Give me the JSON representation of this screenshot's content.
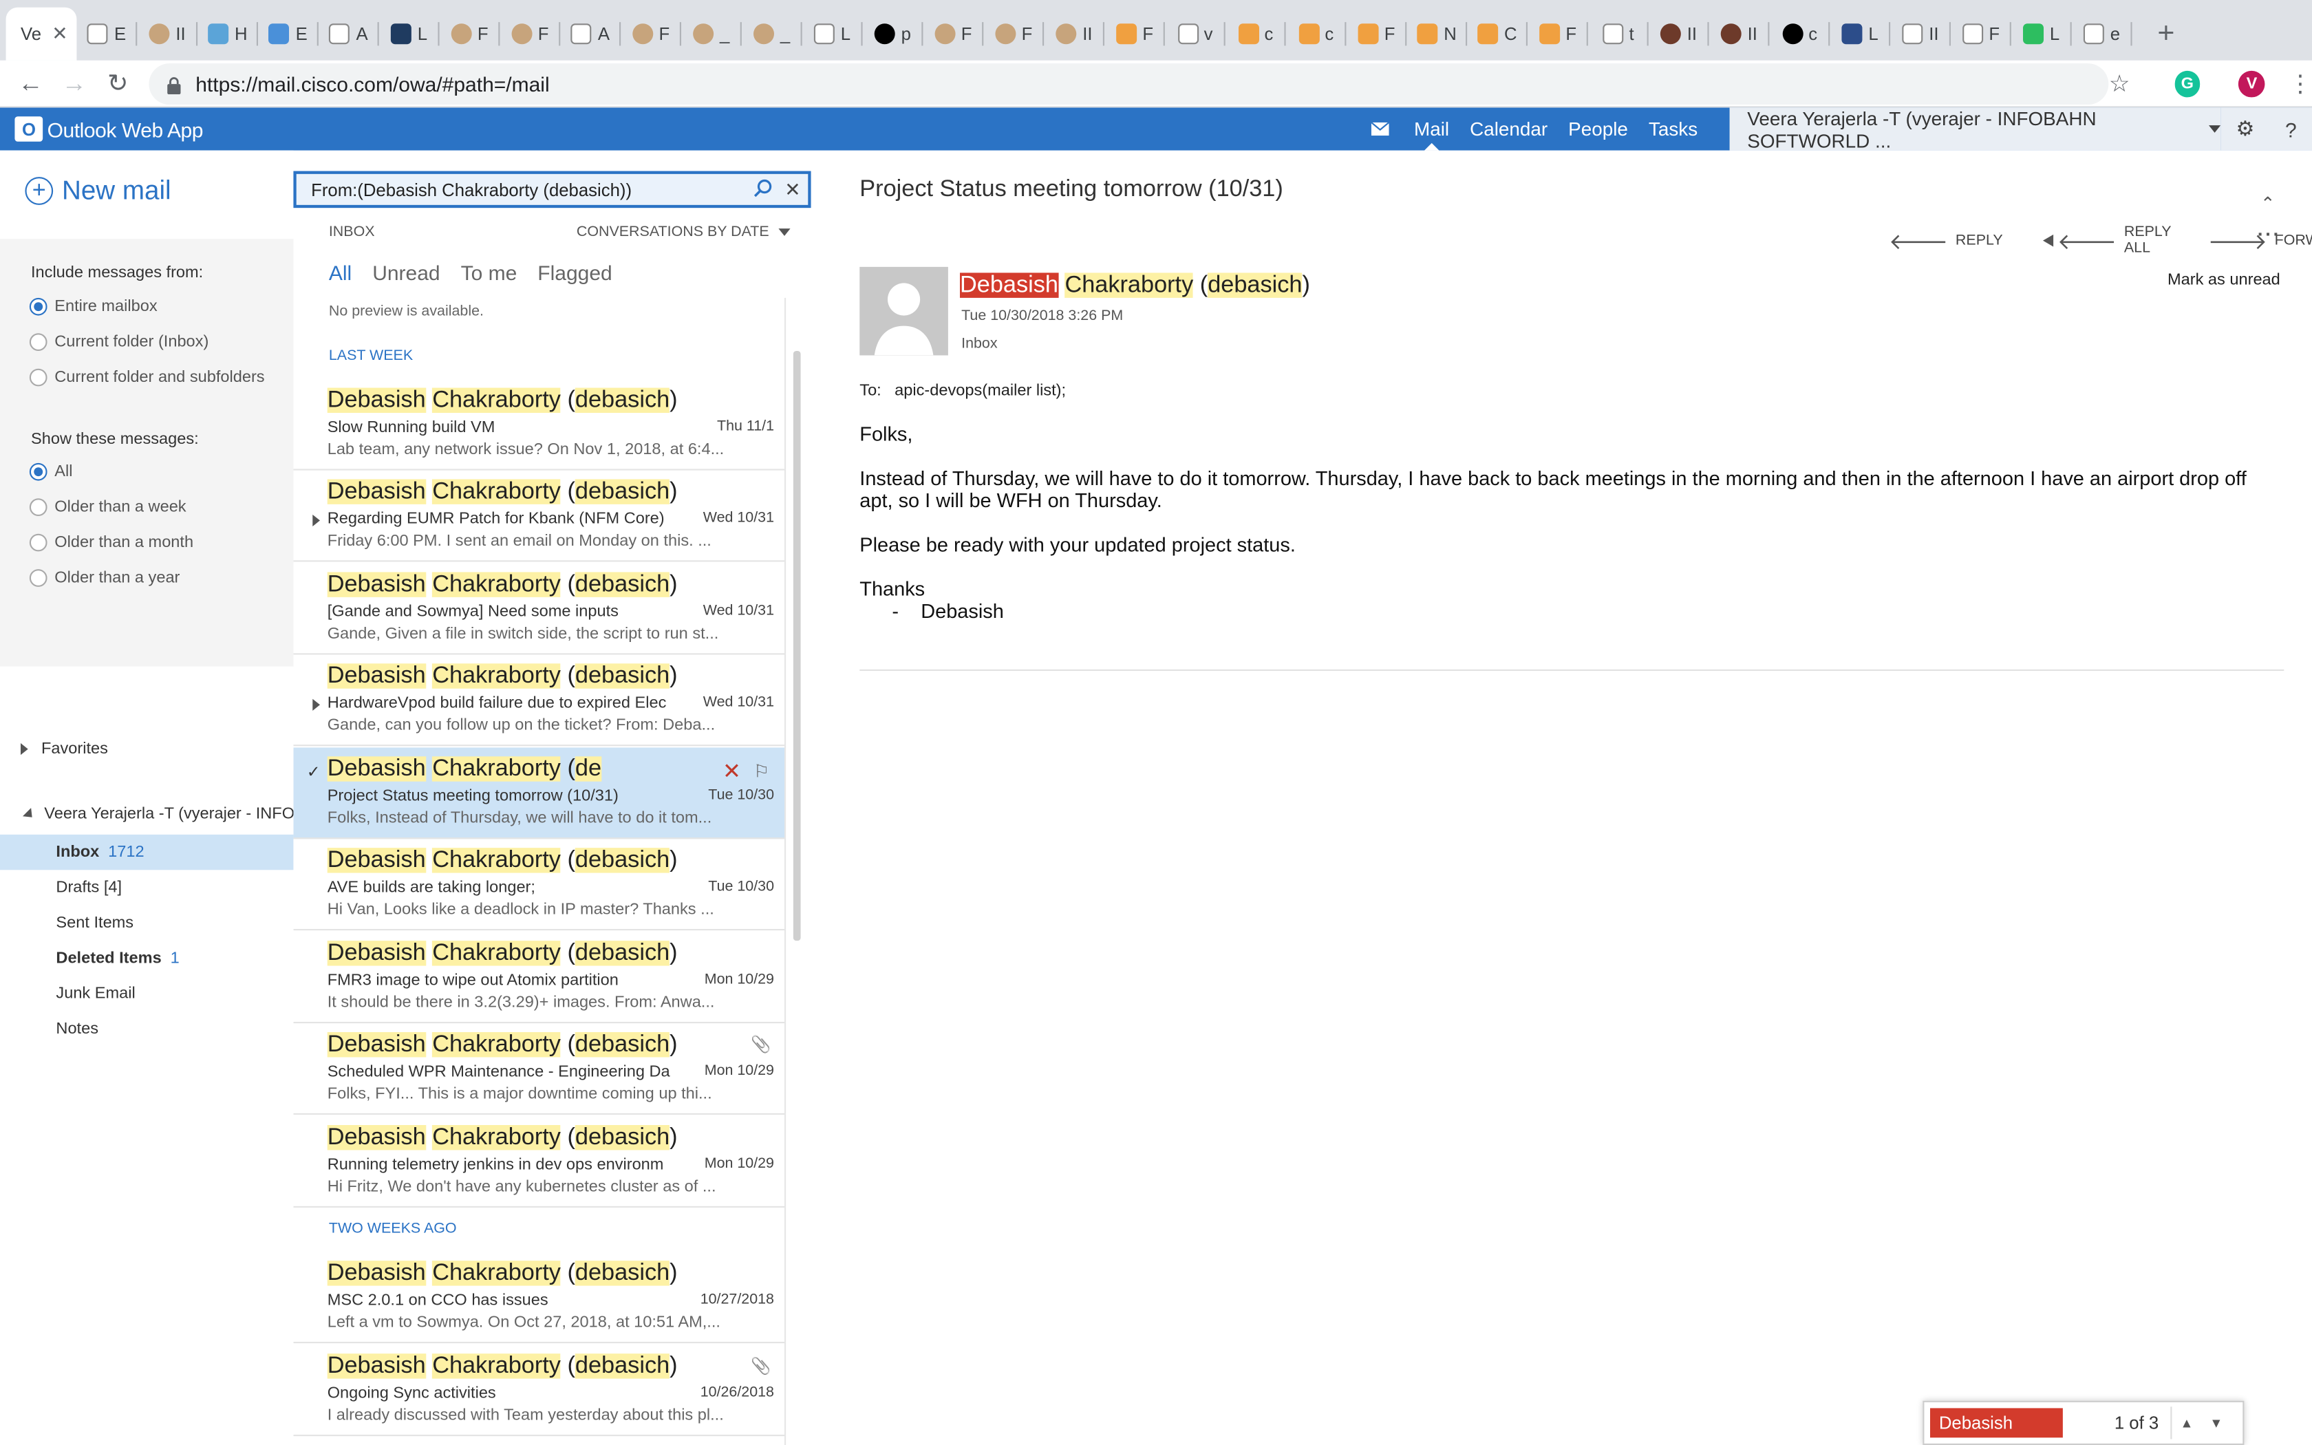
{
  "browser": {
    "active_tab_label": "Ve",
    "tabs": [
      {
        "icon": "document-icon",
        "label": "E"
      },
      {
        "icon": "avatar-icon",
        "label": "II"
      },
      {
        "icon": "chat-icon",
        "label": "H"
      },
      {
        "icon": "refresh-app-icon",
        "label": "E"
      },
      {
        "icon": "document-icon",
        "label": "A"
      },
      {
        "icon": "webex-icon",
        "label": "L"
      },
      {
        "icon": "avatar-icon",
        "label": "F"
      },
      {
        "icon": "avatar-icon",
        "label": "F"
      },
      {
        "icon": "document-icon",
        "label": "A"
      },
      {
        "icon": "avatar-icon",
        "label": "F"
      },
      {
        "icon": "avatar-icon",
        "label": "_"
      },
      {
        "icon": "avatar-icon",
        "label": "_"
      },
      {
        "icon": "diamond-icon",
        "label": "L"
      },
      {
        "icon": "github-icon",
        "label": "p"
      },
      {
        "icon": "avatar-icon",
        "label": "F"
      },
      {
        "icon": "avatar-icon",
        "label": "F"
      },
      {
        "icon": "avatar-icon",
        "label": "II"
      },
      {
        "icon": "wave-icon",
        "label": "F"
      },
      {
        "icon": "google-icon",
        "label": "v"
      },
      {
        "icon": "wave-icon",
        "label": "c"
      },
      {
        "icon": "wave-icon",
        "label": "c"
      },
      {
        "icon": "wave-icon",
        "label": "F"
      },
      {
        "icon": "wave-icon",
        "label": "N"
      },
      {
        "icon": "wave-icon",
        "label": "C"
      },
      {
        "icon": "wave-icon",
        "label": "F"
      },
      {
        "icon": "document-icon",
        "label": "t"
      },
      {
        "icon": "dark-avatar-icon",
        "label": "II"
      },
      {
        "icon": "dark-avatar-icon",
        "label": "II"
      },
      {
        "icon": "angular-icon",
        "label": "c"
      },
      {
        "icon": "photo-icon",
        "label": "L"
      },
      {
        "icon": "gmail-icon",
        "label": "II"
      },
      {
        "icon": "gmail-icon",
        "label": "F"
      },
      {
        "icon": "evernote-icon",
        "label": "L"
      },
      {
        "icon": "google-icon",
        "label": "e"
      }
    ],
    "url": "https://mail.cisco.com/owa/#path=/mail",
    "profile_initial": "V"
  },
  "owa": {
    "app_name": "Outlook Web App",
    "nav": [
      "Mail",
      "Calendar",
      "People",
      "Tasks"
    ],
    "selected_nav": "Mail",
    "user": "Veera Yerajerla -T (vyerajer - INFOBAHN SOFTWORLD ..."
  },
  "left": {
    "new_mail": "New mail",
    "include_label": "Include messages from:",
    "include_options": [
      "Entire mailbox",
      "Current folder (Inbox)",
      "Current folder and subfolders"
    ],
    "show_label": "Show these messages:",
    "show_options": [
      "All",
      "Older than a week",
      "Older than a month",
      "Older than a year"
    ],
    "favorites": "Favorites",
    "account": "Veera Yerajerla -T (vyerajer - INFOB",
    "folders": [
      {
        "name": "Inbox",
        "count": "1712"
      },
      {
        "name": "Drafts [4]",
        "count": ""
      },
      {
        "name": "Sent Items",
        "count": ""
      },
      {
        "name": "Deleted Items",
        "count": "1"
      },
      {
        "name": "Junk Email",
        "count": ""
      },
      {
        "name": "Notes",
        "count": ""
      }
    ]
  },
  "list": {
    "search_value": "From:(Debasish Chakraborty (debasich))",
    "folder_label": "INBOX",
    "sort_label": "CONVERSATIONS BY DATE",
    "filters": [
      "All",
      "Unread",
      "To me",
      "Flagged"
    ],
    "top_preview": "No preview is available.",
    "group_last_week": "LAST WEEK",
    "group_two_weeks": "TWO WEEKS AGO",
    "from_first": "Debasish",
    "from_last": "Chakraborty",
    "from_alias": "debasich",
    "from_alias_truncated": "de",
    "items": [
      {
        "subject": "Slow Running build VM",
        "date": "Thu 11/1",
        "preview": "Lab team, any network issue?  On Nov 1, 2018, at 6:4..."
      },
      {
        "subject": "Regarding EUMR Patch for Kbank (NFM Core)",
        "date": "Wed 10/31",
        "preview": "Friday 6:00 PM. I sent an email on Monday on this.   ..."
      },
      {
        "subject": "[Gande and Sowmya] Need some inputs",
        "date": "Wed 10/31",
        "preview": "Gande,  Given a file in switch side, the script to run st..."
      },
      {
        "subject": "HardwareVpod build failure due to expired Elec",
        "date": "Wed 10/31",
        "preview": "Gande, can you follow up on the ticket?  From: Deba..."
      },
      {
        "subject": "Project Status meeting tomorrow (10/31)",
        "date": "Tue 10/30",
        "preview": "Folks,  Instead of Thursday, we will have to do it tom..."
      },
      {
        "subject": "AVE builds are taking longer;",
        "date": "Tue 10/30",
        "preview": "Hi Van,  Looks like a deadlock in IP master?  Thanks  ..."
      },
      {
        "subject": "FMR3 image to wipe out Atomix partition",
        "date": "Mon 10/29",
        "preview": "It should be there in 3.2(3.29)+ images.  From: Anwa..."
      },
      {
        "subject": "Scheduled WPR Maintenance - Engineering Da",
        "date": "Mon 10/29",
        "preview": "Folks,  FYI...  This is a major downtime coming up thi..."
      },
      {
        "subject": "Running telemetry jenkins in dev ops environm",
        "date": "Mon 10/29",
        "preview": "Hi Fritz,  We don't have any kubernetes cluster as of ..."
      },
      {
        "subject": "MSC 2.0.1 on CCO has issues",
        "date": "10/27/2018",
        "preview": "Left a vm to Sowmya.  On Oct 27, 2018, at 10:51 AM,..."
      },
      {
        "subject": "Ongoing Sync activities",
        "date": "10/26/2018",
        "preview": "I already discussed with Team yesterday about this pl..."
      }
    ]
  },
  "reading": {
    "subject": "Project Status meeting tomorrow (10/31)",
    "actions": [
      "REPLY",
      "REPLY ALL",
      "FORWARD"
    ],
    "sender_first": "Debasish",
    "sender_last": "Chakraborty",
    "sender_alias": "debasich",
    "sent": "Tue 10/30/2018 3:26 PM",
    "folder": "Inbox",
    "mark_unread": "Mark as unread",
    "to_label": "To:",
    "to_value": "apic-devops(mailer list);",
    "body": [
      "Folks,",
      "Instead of Thursday, we will have to do it tomorrow. Thursday, I have back to back meetings in the morning and then in the afternoon I have an airport drop off apt, so I will be WFH on Thursday.",
      "Please be ready with your updated project status.",
      "Thanks"
    ],
    "signature_dash": "-",
    "signature": "Debasish"
  },
  "find": {
    "query": "Debasish",
    "count": "1 of 3"
  },
  "colors": {
    "owa_blue": "#2b73c5",
    "highlight": "#fdf1a5",
    "highlight_active": "#d33b2c",
    "selection": "#cde3f6"
  }
}
